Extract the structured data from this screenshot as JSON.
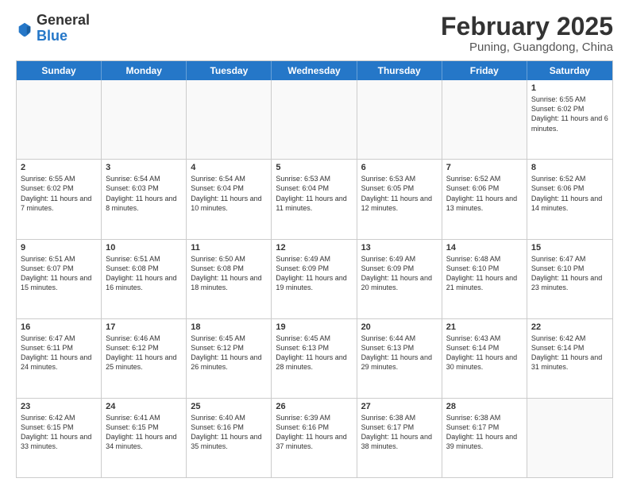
{
  "logo": {
    "general": "General",
    "blue": "Blue"
  },
  "header": {
    "month": "February 2025",
    "location": "Puning, Guangdong, China"
  },
  "weekdays": [
    "Sunday",
    "Monday",
    "Tuesday",
    "Wednesday",
    "Thursday",
    "Friday",
    "Saturday"
  ],
  "rows": [
    [
      {
        "day": "",
        "text": "",
        "empty": true
      },
      {
        "day": "",
        "text": "",
        "empty": true
      },
      {
        "day": "",
        "text": "",
        "empty": true
      },
      {
        "day": "",
        "text": "",
        "empty": true
      },
      {
        "day": "",
        "text": "",
        "empty": true
      },
      {
        "day": "",
        "text": "",
        "empty": true
      },
      {
        "day": "1",
        "text": "Sunrise: 6:55 AM\nSunset: 6:02 PM\nDaylight: 11 hours and 6 minutes."
      }
    ],
    [
      {
        "day": "2",
        "text": "Sunrise: 6:55 AM\nSunset: 6:02 PM\nDaylight: 11 hours and 7 minutes."
      },
      {
        "day": "3",
        "text": "Sunrise: 6:54 AM\nSunset: 6:03 PM\nDaylight: 11 hours and 8 minutes."
      },
      {
        "day": "4",
        "text": "Sunrise: 6:54 AM\nSunset: 6:04 PM\nDaylight: 11 hours and 10 minutes."
      },
      {
        "day": "5",
        "text": "Sunrise: 6:53 AM\nSunset: 6:04 PM\nDaylight: 11 hours and 11 minutes."
      },
      {
        "day": "6",
        "text": "Sunrise: 6:53 AM\nSunset: 6:05 PM\nDaylight: 11 hours and 12 minutes."
      },
      {
        "day": "7",
        "text": "Sunrise: 6:52 AM\nSunset: 6:06 PM\nDaylight: 11 hours and 13 minutes."
      },
      {
        "day": "8",
        "text": "Sunrise: 6:52 AM\nSunset: 6:06 PM\nDaylight: 11 hours and 14 minutes."
      }
    ],
    [
      {
        "day": "9",
        "text": "Sunrise: 6:51 AM\nSunset: 6:07 PM\nDaylight: 11 hours and 15 minutes."
      },
      {
        "day": "10",
        "text": "Sunrise: 6:51 AM\nSunset: 6:08 PM\nDaylight: 11 hours and 16 minutes."
      },
      {
        "day": "11",
        "text": "Sunrise: 6:50 AM\nSunset: 6:08 PM\nDaylight: 11 hours and 18 minutes."
      },
      {
        "day": "12",
        "text": "Sunrise: 6:49 AM\nSunset: 6:09 PM\nDaylight: 11 hours and 19 minutes."
      },
      {
        "day": "13",
        "text": "Sunrise: 6:49 AM\nSunset: 6:09 PM\nDaylight: 11 hours and 20 minutes."
      },
      {
        "day": "14",
        "text": "Sunrise: 6:48 AM\nSunset: 6:10 PM\nDaylight: 11 hours and 21 minutes."
      },
      {
        "day": "15",
        "text": "Sunrise: 6:47 AM\nSunset: 6:10 PM\nDaylight: 11 hours and 23 minutes."
      }
    ],
    [
      {
        "day": "16",
        "text": "Sunrise: 6:47 AM\nSunset: 6:11 PM\nDaylight: 11 hours and 24 minutes."
      },
      {
        "day": "17",
        "text": "Sunrise: 6:46 AM\nSunset: 6:12 PM\nDaylight: 11 hours and 25 minutes."
      },
      {
        "day": "18",
        "text": "Sunrise: 6:45 AM\nSunset: 6:12 PM\nDaylight: 11 hours and 26 minutes."
      },
      {
        "day": "19",
        "text": "Sunrise: 6:45 AM\nSunset: 6:13 PM\nDaylight: 11 hours and 28 minutes."
      },
      {
        "day": "20",
        "text": "Sunrise: 6:44 AM\nSunset: 6:13 PM\nDaylight: 11 hours and 29 minutes."
      },
      {
        "day": "21",
        "text": "Sunrise: 6:43 AM\nSunset: 6:14 PM\nDaylight: 11 hours and 30 minutes."
      },
      {
        "day": "22",
        "text": "Sunrise: 6:42 AM\nSunset: 6:14 PM\nDaylight: 11 hours and 31 minutes."
      }
    ],
    [
      {
        "day": "23",
        "text": "Sunrise: 6:42 AM\nSunset: 6:15 PM\nDaylight: 11 hours and 33 minutes."
      },
      {
        "day": "24",
        "text": "Sunrise: 6:41 AM\nSunset: 6:15 PM\nDaylight: 11 hours and 34 minutes."
      },
      {
        "day": "25",
        "text": "Sunrise: 6:40 AM\nSunset: 6:16 PM\nDaylight: 11 hours and 35 minutes."
      },
      {
        "day": "26",
        "text": "Sunrise: 6:39 AM\nSunset: 6:16 PM\nDaylight: 11 hours and 37 minutes."
      },
      {
        "day": "27",
        "text": "Sunrise: 6:38 AM\nSunset: 6:17 PM\nDaylight: 11 hours and 38 minutes."
      },
      {
        "day": "28",
        "text": "Sunrise: 6:38 AM\nSunset: 6:17 PM\nDaylight: 11 hours and 39 minutes."
      },
      {
        "day": "",
        "text": "",
        "empty": true
      }
    ]
  ]
}
